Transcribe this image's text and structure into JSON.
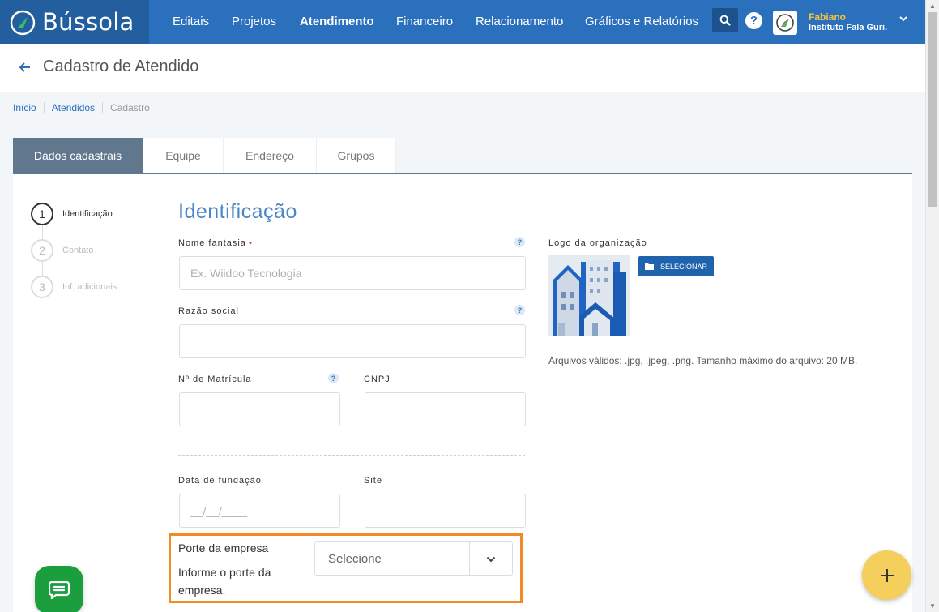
{
  "app": {
    "name": "Bússola"
  },
  "nav": {
    "items": [
      {
        "label": "Editais",
        "active": false
      },
      {
        "label": "Projetos",
        "active": false
      },
      {
        "label": "Atendimento",
        "active": true
      },
      {
        "label": "Financeiro",
        "active": false
      },
      {
        "label": "Relacionamento",
        "active": false
      },
      {
        "label": "Gráficos e Relatórios",
        "active": false
      }
    ],
    "search_icon": "search-icon",
    "help_icon": "question-icon"
  },
  "user": {
    "name": "Fabiano",
    "organization": "Instituto Fala Guri."
  },
  "page": {
    "title": "Cadastro de Atendido"
  },
  "breadcrumb": [
    "Início",
    "Atendidos",
    "Cadastro"
  ],
  "tabs": [
    {
      "label": "Dados cadastrais",
      "active": true
    },
    {
      "label": "Equipe",
      "active": false
    },
    {
      "label": "Endereço",
      "active": false
    },
    {
      "label": "Grupos",
      "active": false
    }
  ],
  "stepper": [
    {
      "number": "1",
      "label": "Identificação",
      "active": true
    },
    {
      "number": "2",
      "label": "Contato",
      "active": false
    },
    {
      "number": "3",
      "label": "Inf. adicionais",
      "active": false
    }
  ],
  "form": {
    "section_title": "Identificação",
    "nome_fantasia": {
      "label": "Nome fantasia",
      "required_mark": "•",
      "placeholder": "Ex. Wiidoo Tecnologia",
      "value": ""
    },
    "razao_social": {
      "label": "Razão social",
      "value": ""
    },
    "matricula": {
      "label": "Nº de Matrícula",
      "value": ""
    },
    "cnpj": {
      "label": "CNPJ",
      "value": ""
    },
    "data_fundacao": {
      "label": "Data de fundação",
      "placeholder": "__/__/____"
    },
    "site": {
      "label": "Site",
      "value": ""
    },
    "porte": {
      "label": "Porte da empresa",
      "help": "Informe o porte da empresa.",
      "selected": "Selecione"
    },
    "help_mark": "?"
  },
  "logo_upload": {
    "label": "Logo da organização",
    "button_label": "SELECIONAR",
    "hint": "Arquivos válidos: .jpg, .jpeg, .png. Tamanho máximo do arquivo: 20 MB."
  },
  "colors": {
    "nav": "#2b70bd",
    "tab_active": "#60778e",
    "highlight": "#f28a25",
    "fab": "#f4cf5b",
    "chat": "#1b9e3e"
  }
}
